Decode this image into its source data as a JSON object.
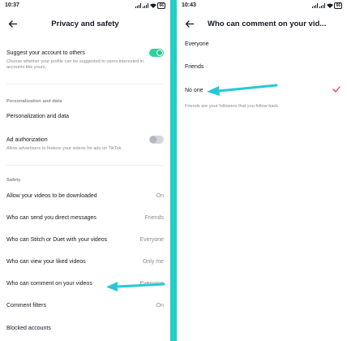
{
  "left": {
    "status": {
      "time": "10:37",
      "battery": "66"
    },
    "title": "Privacy and safety",
    "suggest": {
      "label": "Suggest your account to others",
      "description": "Choose whether your profile can be suggested to users interested in accounts like yours.",
      "enabled": true
    },
    "personalization": {
      "header": "Personalization and data",
      "item": "Personalization and data"
    },
    "ad_auth": {
      "label": "Ad authorization",
      "description": "Allow advertisers to feature your videos for ads on TikTok.",
      "enabled": false
    },
    "safety": {
      "header": "Safety",
      "items": [
        {
          "label": "Allow your videos to be downloaded",
          "value": "On"
        },
        {
          "label": "Who can send you direct messages",
          "value": "Friends"
        },
        {
          "label": "Who can Stitch or Duet with your videos",
          "value": "Everyone"
        },
        {
          "label": "Who can view your liked videos",
          "value": "Only me"
        },
        {
          "label": "Who can comment on your videos",
          "value": "Everyone"
        },
        {
          "label": "Comment filters",
          "value": "On"
        },
        {
          "label": "Blocked accounts",
          "value": ""
        }
      ]
    }
  },
  "right": {
    "status": {
      "time": "10:43",
      "battery": "66"
    },
    "title": "Who can comment on your vid...",
    "options": [
      {
        "label": "Everyone",
        "selected": false
      },
      {
        "label": "Friends",
        "selected": false
      },
      {
        "label": "No one",
        "selected": true
      }
    ],
    "note": "Friends are your followers that you follow back."
  },
  "colors": {
    "accent_bg": "#22cfc4",
    "annotation_arrow": "#25c9d6",
    "toggle_on": "#2dd4a0",
    "check": "#ea3b5c"
  },
  "icons": {
    "back": "back-arrow-icon",
    "check": "check-icon",
    "signal": "signal-icon",
    "wifi": "wifi-icon",
    "battery": "battery-icon",
    "annotation": "annotation-arrow-icon"
  }
}
